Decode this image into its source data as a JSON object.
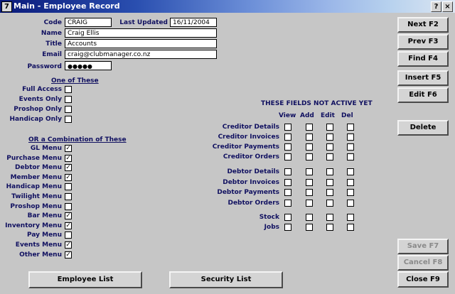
{
  "window": {
    "title": "Main - Employee Record",
    "help": "?",
    "close": "×"
  },
  "form": {
    "code_label": "Code",
    "code_value": "CRAIG",
    "updated_label": "Last Updated",
    "updated_value": "16/11/2004",
    "name_label": "Name",
    "name_value": "Craig Ellis",
    "title_label": "Title",
    "title_value": "Accounts",
    "email_label": "Email",
    "email_value": "craig@clubmanager.co.nz",
    "password_label": "Password",
    "password_value": "●●●●●"
  },
  "one_of": {
    "heading": "One of These",
    "items": [
      {
        "label": "Full Access",
        "checked": false
      },
      {
        "label": "Events Only",
        "checked": false
      },
      {
        "label": "Proshop Only",
        "checked": false
      },
      {
        "label": "Handicap Only",
        "checked": false
      }
    ]
  },
  "combo": {
    "heading": "OR a Combination of These",
    "items": [
      {
        "label": "GL Menu",
        "checked": true
      },
      {
        "label": "Purchase Menu",
        "checked": true
      },
      {
        "label": "Debtor Menu",
        "checked": true
      },
      {
        "label": "Member Menu",
        "checked": true
      },
      {
        "label": "Handicap Menu",
        "checked": false
      },
      {
        "label": "Twilight Menu",
        "checked": false
      },
      {
        "label": "Proshop Menu",
        "checked": false
      },
      {
        "label": "Bar Menu",
        "checked": true
      },
      {
        "label": "Inventory Menu",
        "checked": true
      },
      {
        "label": "Pay Menu",
        "checked": false
      },
      {
        "label": "Events Menu",
        "checked": true
      },
      {
        "label": "Other Menu",
        "checked": true
      }
    ]
  },
  "security": {
    "heading": "THESE FIELDS NOT ACTIVE YET",
    "columns": [
      "View",
      "Add",
      "Edit",
      "Del"
    ],
    "rows": [
      {
        "label": "Creditor Details"
      },
      {
        "label": "Creditor Invoices"
      },
      {
        "label": "Creditor Payments"
      },
      {
        "label": "Creditor Orders"
      },
      {
        "label": "Debtor Details"
      },
      {
        "label": "Debtor Invoices"
      },
      {
        "label": "Debtor Payments"
      },
      {
        "label": "Debtor Orders"
      },
      {
        "label": "Stock"
      },
      {
        "label": "Jobs"
      }
    ]
  },
  "buttons": {
    "next": "Next F2",
    "prev": "Prev F3",
    "find": "Find F4",
    "insert": "Insert F5",
    "edit": "Edit F6",
    "delete": "Delete",
    "save": "Save F7",
    "cancel": "Cancel F8",
    "close": "Close F9",
    "employee_list": "Employee List",
    "security_list": "Security List"
  }
}
